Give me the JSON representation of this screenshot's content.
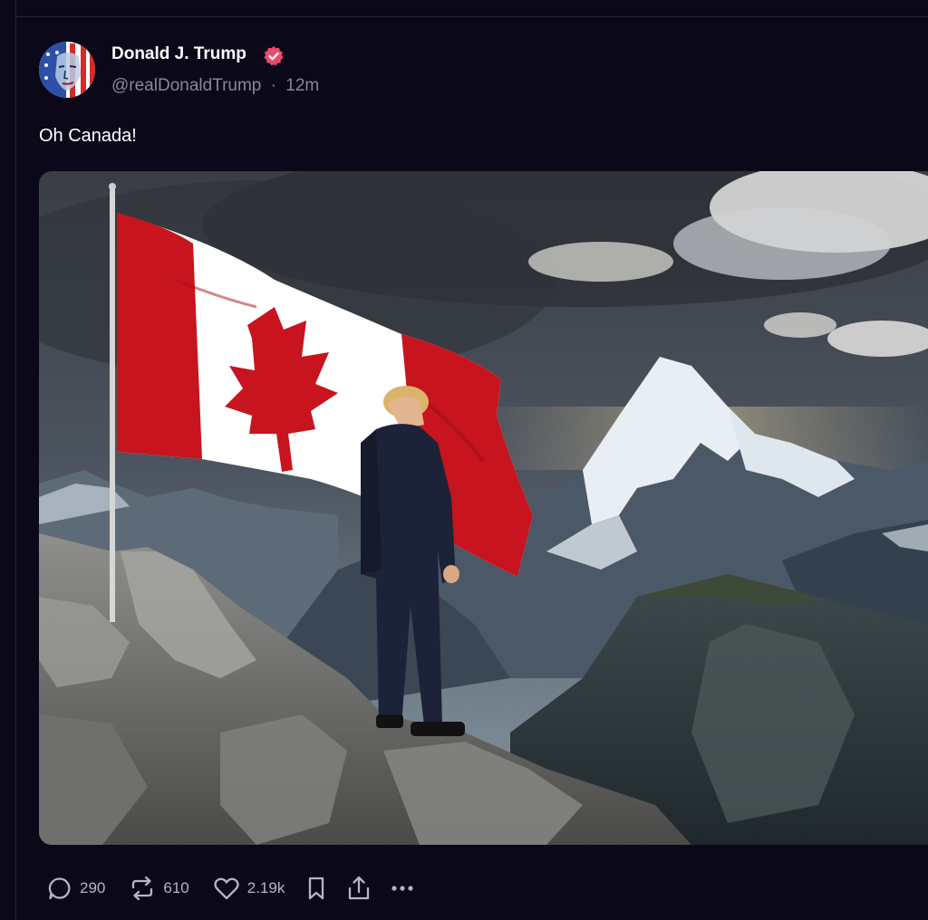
{
  "post": {
    "author_name": "Donald J. Trump",
    "handle": "@realDonaldTrump",
    "separator": "·",
    "time": "12m",
    "text": "Oh Canada!"
  },
  "actions": {
    "replies": "290",
    "reposts": "610",
    "likes": "2.19k"
  },
  "icons": {
    "verified": "verified-badge-icon",
    "reply": "speech-bubble-icon",
    "repost": "repost-arrows-icon",
    "like": "heart-icon",
    "bookmark": "bookmark-icon",
    "share": "share-upload-icon",
    "more": "more-dots-icon"
  },
  "colors": {
    "background": "#0b0819",
    "secondary_text": "#8a8698",
    "verified_badge": "#e94a6d",
    "flag_red": "#c8141e"
  }
}
